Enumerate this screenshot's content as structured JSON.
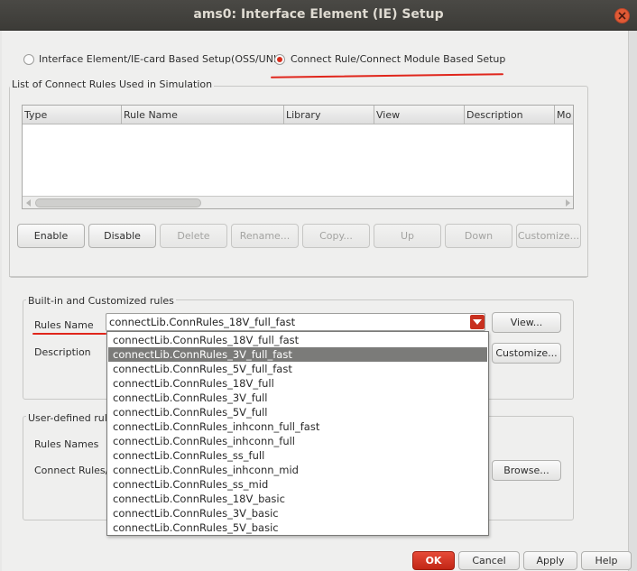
{
  "window": {
    "title": "ams0: Interface Element (IE) Setup"
  },
  "setup_mode": {
    "option_ie": "Interface Element/IE-card Based Setup(OSS/UNL)",
    "option_connect": "Connect Rule/Connect Module Based Setup",
    "selected": "connect"
  },
  "connect_rules_list": {
    "title": "List of Connect Rules Used in Simulation",
    "columns": [
      "Type",
      "Rule Name",
      "Library",
      "View",
      "Description",
      "Mo"
    ],
    "rows": []
  },
  "list_buttons": {
    "enable": "Enable",
    "disable": "Disable",
    "delete": "Delete",
    "rename": "Rename...",
    "copy": "Copy...",
    "up": "Up",
    "down": "Down",
    "customize": "Customize..."
  },
  "builtin_group": {
    "title": "Built-in and Customized rules",
    "rules_name_label": "Rules Name",
    "rules_name_value": "connectLib.ConnRules_18V_full_fast",
    "description_label": "Description",
    "view_button": "View...",
    "customize_button": "Customize..."
  },
  "rules_dropdown": {
    "selected": "connectLib.ConnRules_3V_full_fast",
    "options": [
      "connectLib.ConnRules_18V_full_fast",
      "connectLib.ConnRules_3V_full_fast",
      "connectLib.ConnRules_5V_full_fast",
      "connectLib.ConnRules_18V_full",
      "connectLib.ConnRules_3V_full",
      "connectLib.ConnRules_5V_full",
      "connectLib.ConnRules_inhconn_full_fast",
      "connectLib.ConnRules_inhconn_full",
      "connectLib.ConnRules_ss_full",
      "connectLib.ConnRules_inhconn_mid",
      "connectLib.ConnRules_ss_mid",
      "connectLib.ConnRules_18V_basic",
      "connectLib.ConnRules_3V_basic",
      "connectLib.ConnRules_5V_basic"
    ]
  },
  "userdefined_group": {
    "title": "User-defined rule",
    "rules_names_label": "Rules Names",
    "connect_rules_label": "Connect Rules/",
    "browse_button": "Browse..."
  },
  "dialog_buttons": {
    "ok": "OK",
    "cancel": "Cancel",
    "apply": "Apply",
    "help": "Help"
  },
  "colors": {
    "accent": "#d72d1c",
    "annotation": "#e0261c",
    "titlebar": "#3c3b37"
  }
}
